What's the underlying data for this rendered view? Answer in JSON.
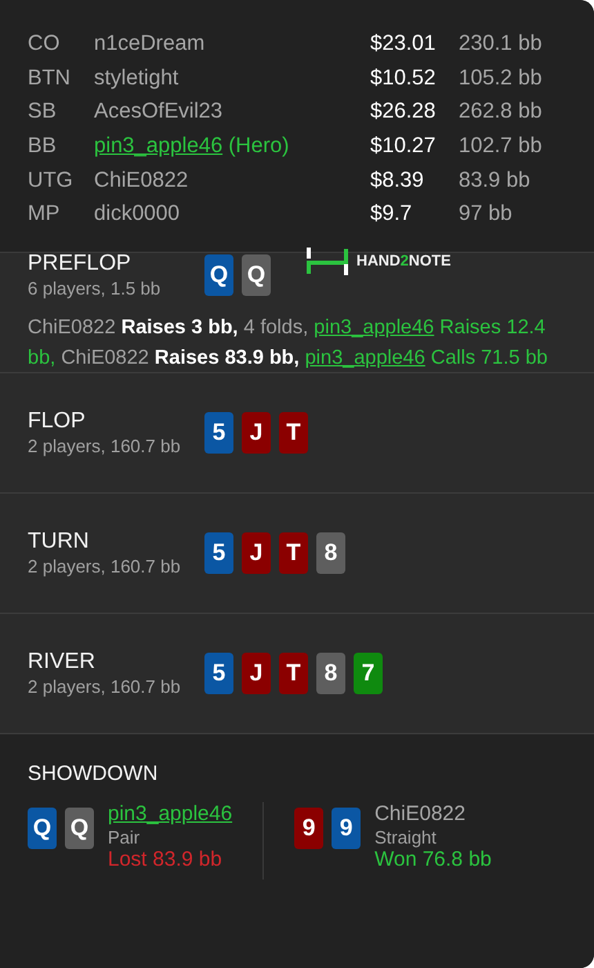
{
  "players": [
    {
      "position": "CO",
      "name": "n1ceDream",
      "hero": false,
      "stack": "$23.01",
      "bb": "230.1 bb"
    },
    {
      "position": "BTN",
      "name": "styletight",
      "hero": false,
      "stack": "$10.52",
      "bb": "105.2 bb"
    },
    {
      "position": "SB",
      "name": "AcesOfEvil23",
      "hero": false,
      "stack": "$26.28",
      "bb": "262.8 bb"
    },
    {
      "position": "BB",
      "name": "pin3_apple46",
      "hero": true,
      "hero_tag": "(Hero)",
      "stack": "$10.27",
      "bb": "102.7 bb"
    },
    {
      "position": "UTG",
      "name": "ChiE0822",
      "hero": false,
      "stack": "$8.39",
      "bb": "83.9 bb"
    },
    {
      "position": "MP",
      "name": "dick0000",
      "hero": false,
      "stack": "$9.7",
      "bb": "97 bb"
    }
  ],
  "streets": [
    {
      "name": "PREFLOP",
      "info": "6 players, 1.5 bb",
      "cards": [
        {
          "rank": "Q",
          "color": "#0b57a4"
        },
        {
          "rank": "Q",
          "color": "#5e5e5e"
        }
      ],
      "logo": {
        "parts": [
          "HAND",
          "2",
          "NOTE"
        ]
      },
      "actions": [
        {
          "kind": "player",
          "text": "ChiE0822"
        },
        {
          "kind": "action",
          "text": " Raises 3 bb,"
        },
        {
          "kind": "plain",
          "text": " 4 folds, "
        },
        {
          "kind": "hero-link",
          "text": "pin3_apple46"
        },
        {
          "kind": "hero",
          "text": " Raises 12.4 bb, "
        },
        {
          "kind": "player",
          "text": "ChiE0822"
        },
        {
          "kind": "action",
          "text": " Raises 83.9 bb, "
        },
        {
          "kind": "hero-link",
          "text": "pin3_apple46"
        },
        {
          "kind": "hero",
          "text": " Calls 71.5 bb"
        }
      ]
    },
    {
      "name": "FLOP",
      "info": "2 players, 160.7 bb",
      "cards": [
        {
          "rank": "5",
          "color": "#0b57a4"
        },
        {
          "rank": "J",
          "color": "#8b0000"
        },
        {
          "rank": "T",
          "color": "#8b0000"
        }
      ]
    },
    {
      "name": "TURN",
      "info": "2 players, 160.7 bb",
      "cards": [
        {
          "rank": "5",
          "color": "#0b57a4"
        },
        {
          "rank": "J",
          "color": "#8b0000"
        },
        {
          "rank": "T",
          "color": "#8b0000"
        },
        {
          "rank": "8",
          "color": "#5e5e5e"
        }
      ]
    },
    {
      "name": "RIVER",
      "info": "2 players, 160.7 bb",
      "cards": [
        {
          "rank": "5",
          "color": "#0b57a4"
        },
        {
          "rank": "J",
          "color": "#8b0000"
        },
        {
          "rank": "T",
          "color": "#8b0000"
        },
        {
          "rank": "8",
          "color": "#5e5e5e"
        },
        {
          "rank": "7",
          "color": "#0f8a0f"
        }
      ]
    }
  ],
  "showdown": {
    "title": "SHOWDOWN",
    "hands": [
      {
        "cards": [
          {
            "rank": "Q",
            "color": "#0b57a4"
          },
          {
            "rank": "Q",
            "color": "#5e5e5e"
          }
        ],
        "name": "pin3_apple46",
        "hero": true,
        "hand": "Pair",
        "result": "Lost 83.9 bb",
        "won": false
      },
      {
        "cards": [
          {
            "rank": "9",
            "color": "#8b0000"
          },
          {
            "rank": "9",
            "color": "#0b57a4"
          }
        ],
        "name": "ChiE0822",
        "hero": false,
        "hand": "Straight",
        "result": "Won 76.8 bb",
        "won": true
      }
    ]
  }
}
